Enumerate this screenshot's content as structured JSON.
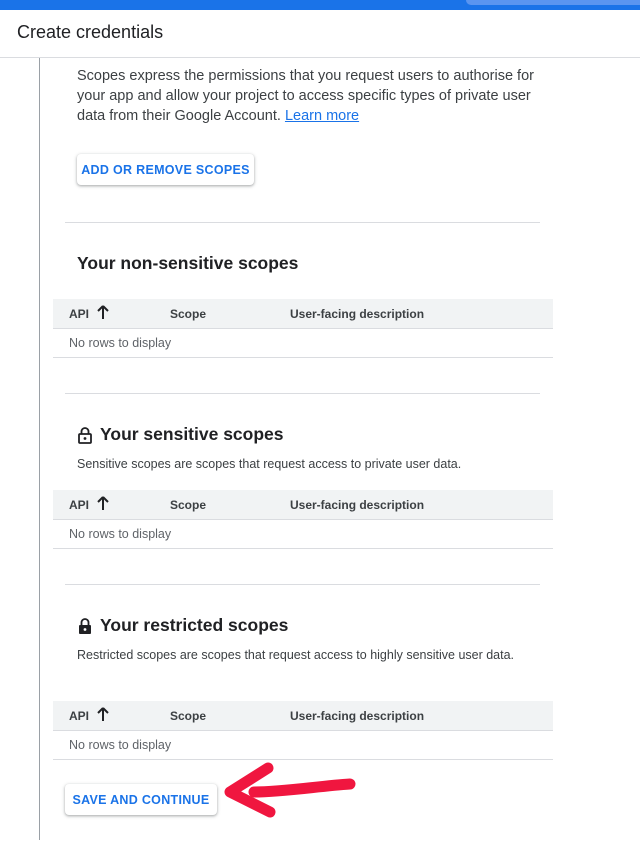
{
  "header": {
    "title": "Create credentials"
  },
  "intro": {
    "text": "Scopes express the permissions that you request users to authorise for your app and allow your project to access specific types of private user data from their Google Account.",
    "link": "Learn more"
  },
  "buttons": {
    "add_remove_scopes": "ADD OR REMOVE SCOPES",
    "save_continue": "SAVE AND CONTINUE"
  },
  "sections": {
    "non_sensitive": {
      "title": "Your non-sensitive scopes",
      "table": {
        "columns": [
          "API",
          "Scope",
          "User-facing description"
        ],
        "empty": "No rows to display"
      }
    },
    "sensitive": {
      "title": "Your sensitive scopes",
      "icon": "lock-open-icon",
      "description": "Sensitive scopes are scopes that request access to private user data.",
      "table": {
        "columns": [
          "API",
          "Scope",
          "User-facing description"
        ],
        "empty": "No rows to display"
      }
    },
    "restricted": {
      "title": "Your restricted scopes",
      "icon": "lock-icon",
      "description": "Restricted scopes are scopes that request access to highly sensitive user data.",
      "table": {
        "columns": [
          "API",
          "Scope",
          "User-facing description"
        ],
        "empty": "No rows to display"
      }
    }
  },
  "colors": {
    "accent": "#1a73e8",
    "annotation_arrow": "#f0163f"
  }
}
